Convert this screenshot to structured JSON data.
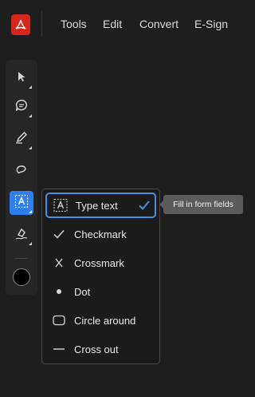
{
  "topbar": {
    "nav": [
      "Tools",
      "Edit",
      "Convert",
      "E-Sign"
    ]
  },
  "toolbar": {
    "tools": [
      {
        "icon": "select-arrow-icon"
      },
      {
        "icon": "comment-icon"
      },
      {
        "icon": "pen-icon"
      },
      {
        "icon": "freeform-lasso-icon"
      },
      {
        "icon": "fill-sign-text-icon",
        "active": true
      },
      {
        "icon": "signature-pen-icon"
      }
    ],
    "current_color": "#000000"
  },
  "menu": {
    "items": [
      {
        "label": "Type text",
        "icon": "text-box-icon",
        "selected": true
      },
      {
        "label": "Checkmark",
        "icon": "checkmark-icon"
      },
      {
        "label": "Crossmark",
        "icon": "crossmark-icon"
      },
      {
        "label": "Dot",
        "icon": "dot-icon"
      },
      {
        "label": "Circle around",
        "icon": "circle-around-icon"
      },
      {
        "label": "Cross out",
        "icon": "cross-out-icon"
      }
    ]
  },
  "tooltip": {
    "text": "Fill in form fields"
  },
  "colors": {
    "accent": "#2d7ff0",
    "brand": "#d7261c",
    "background": "#1e1e1e"
  }
}
